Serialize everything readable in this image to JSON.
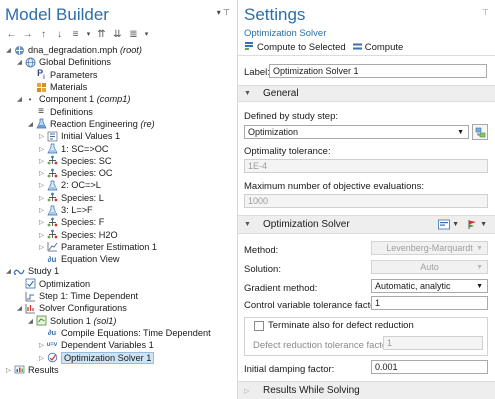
{
  "model_builder": {
    "title": "Model Builder",
    "menu_glyph": "▾ ⊤",
    "toolbar": [
      {
        "name": "back-arrow-icon",
        "glyph": "←"
      },
      {
        "name": "forward-arrow-icon",
        "glyph": "→"
      },
      {
        "name": "move-up-icon",
        "glyph": "↑"
      },
      {
        "name": "move-down-icon",
        "glyph": "↓"
      },
      {
        "name": "show-icon",
        "glyph": "≡"
      },
      {
        "name": "show-menu-icon",
        "glyph": "▾"
      },
      {
        "name": "collapse-all-icon",
        "glyph": "⇈"
      },
      {
        "name": "expand-all-icon",
        "glyph": "⇊"
      },
      {
        "name": "tree-options-icon",
        "glyph": "≣"
      },
      {
        "name": "tree-options-menu-icon",
        "glyph": "▾"
      }
    ],
    "tree": [
      {
        "label": "dna_degradation.mph",
        "suffix": "(root)"
      },
      {
        "label": "Global Definitions"
      },
      {
        "label": "Parameters",
        "prefix": "P",
        "sub": "i"
      },
      {
        "label": "Materials"
      },
      {
        "label": "Component 1",
        "suffix": "(comp1)"
      },
      {
        "label": "Definitions"
      },
      {
        "label": "Reaction Engineering",
        "suffix": "(re)"
      },
      {
        "label": "Initial Values 1"
      },
      {
        "label": "1: SC=>OC"
      },
      {
        "label": "Species: SC"
      },
      {
        "label": "Species: OC"
      },
      {
        "label": "2: OC=>L"
      },
      {
        "label": "Species: L"
      },
      {
        "label": "3: L=>F"
      },
      {
        "label": "Species: F"
      },
      {
        "label": "Species: H2O"
      },
      {
        "label": "Parameter Estimation 1"
      },
      {
        "label": "Equation View"
      },
      {
        "label": "Study 1"
      },
      {
        "label": "Optimization"
      },
      {
        "label": "Step 1: Time Dependent"
      },
      {
        "label": "Solver Configurations"
      },
      {
        "label": "Solution 1",
        "suffix": "(sol1)"
      },
      {
        "label": "Compile Equations: Time Dependent"
      },
      {
        "label": "Dependent Variables 1"
      },
      {
        "label": "Optimization Solver 1"
      },
      {
        "label": "Results"
      }
    ]
  },
  "settings": {
    "title": "Settings",
    "menu_glyph": "⊤",
    "subtitle": "Optimization Solver",
    "compute_to_selected": "Compute to Selected",
    "compute": "Compute",
    "label_caption": "Label:",
    "label_value": "Optimization Solver 1",
    "general": {
      "header": "General",
      "defined_by_caption": "Defined by study step:",
      "defined_by_value": "Optimization",
      "opt_tol_caption": "Optimality tolerance:",
      "opt_tol_value": "1E-4",
      "max_eval_caption": "Maximum number of objective evaluations:",
      "max_eval_value": "1000"
    },
    "solver": {
      "header": "Optimization Solver",
      "method_caption": "Method:",
      "method_value": "Levenberg-Marquardt",
      "solution_caption": "Solution:",
      "solution_value": "Auto",
      "gradient_caption": "Gradient method:",
      "gradient_value": "Automatic, analytic",
      "cv_tol_caption": "Control variable tolerance factor:",
      "cv_tol_value": "1",
      "terminate_caption": "Terminate also for defect reduction",
      "defect_tol_caption": "Defect reduction tolerance factor:",
      "defect_tol_value": "1",
      "damping_caption": "Initial damping factor:",
      "damping_value": "0.001"
    },
    "results_header": "Results While Solving"
  }
}
